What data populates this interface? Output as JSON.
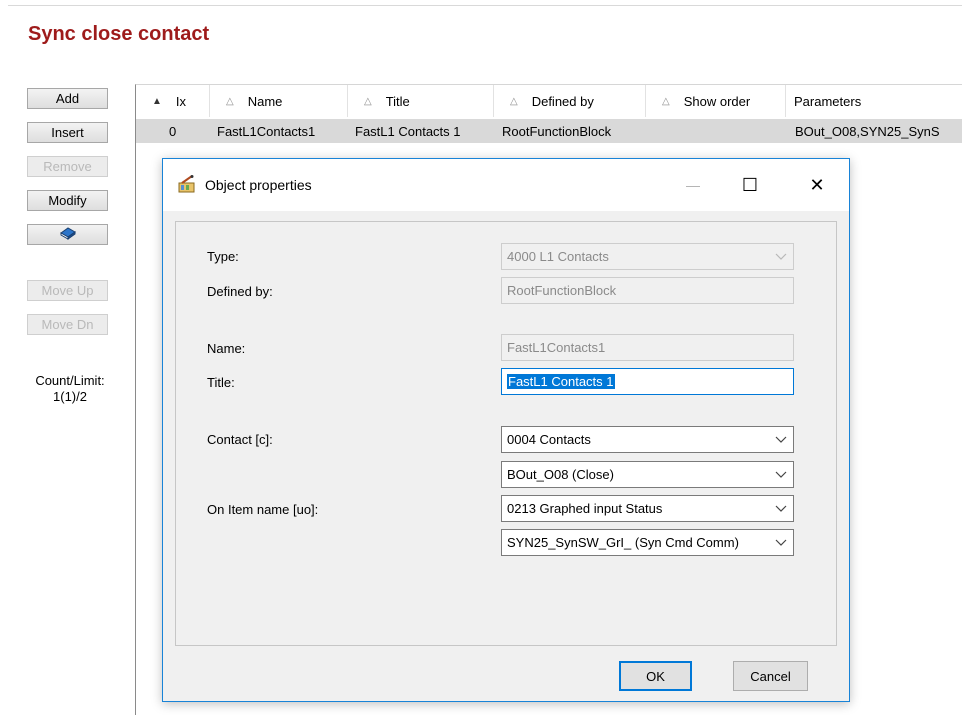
{
  "page": {
    "title": "Sync close contact"
  },
  "left_buttons": {
    "add": "Add",
    "insert": "Insert",
    "remove": "Remove",
    "modify": "Modify",
    "book_icon": "book-icon",
    "move_up": "Move Up",
    "move_dn": "Move Dn"
  },
  "count": {
    "label": "Count/Limit:",
    "value": "1(1)/2"
  },
  "grid": {
    "columns": [
      "Ix",
      "Name",
      "Title",
      "Defined by",
      "Show order",
      "Parameters"
    ],
    "rows": [
      {
        "ix": "0",
        "name": "FastL1Contacts1",
        "title": "FastL1 Contacts 1",
        "defined_by": "RootFunctionBlock",
        "show_order": "",
        "parameters": "BOut_O08,SYN25_SynS"
      }
    ]
  },
  "dialog": {
    "title": "Object properties",
    "controls": {
      "minimize": "—",
      "maximize": "☐",
      "close": "✕"
    },
    "labels": {
      "type": "Type:",
      "defined_by": "Defined by:",
      "name": "Name:",
      "title": "Title:",
      "contact": "Contact [c]:",
      "on_item": "On Item name [uo]:"
    },
    "fields": {
      "type": "4000  L1 Contacts",
      "defined_by": "RootFunctionBlock",
      "name": "FastL1Contacts1",
      "title": "FastL1 Contacts 1",
      "contact_1": "0004  Contacts",
      "contact_2": "BOut_O08 (Close)",
      "on_item_1": "0213  Graphed input Status",
      "on_item_2": "SYN25_SynSW_GrI_ (Syn Cmd Comm)"
    },
    "buttons": {
      "ok": "OK",
      "cancel": "Cancel"
    }
  },
  "colors": {
    "title_red": "#9e1b1b",
    "accent_blue": "#0078d7",
    "row_selected": "#d9d9d9"
  }
}
